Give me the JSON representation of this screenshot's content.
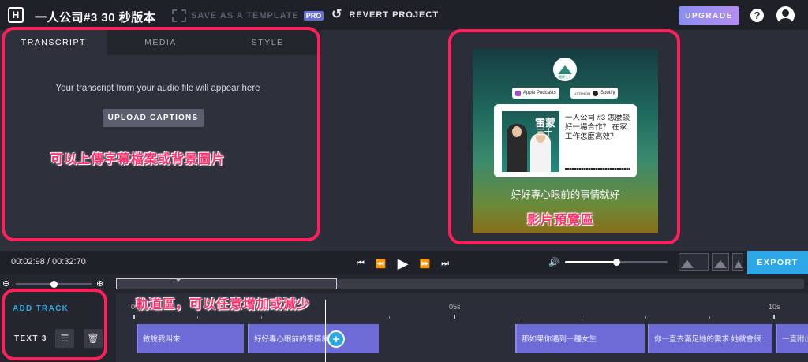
{
  "header": {
    "logo": "H",
    "project_title": "一人公司#3 30 秒版本",
    "save_template": "SAVE AS A TEMPLATE",
    "pro_badge": "PRO",
    "revert": "REVERT PROJECT",
    "upgrade": "UPGRADE",
    "help": "?"
  },
  "left_panel": {
    "tabs": [
      {
        "label": "TRANSCRIPT",
        "active": true
      },
      {
        "label": "MEDIA",
        "active": false
      },
      {
        "label": "STYLE",
        "active": false
      }
    ],
    "message": "Your transcript from your audio file will appear here",
    "upload_button": "UPLOAD CAPTIONS"
  },
  "annotations": {
    "left": "可以上傳字幕檔案或背景圖片",
    "preview": "影片預覽區",
    "timeline": "軌道區，可以任意增加或減少"
  },
  "preview": {
    "logo_text": "雷蒙三十",
    "badge_apple": "Apple Podcasts",
    "badge_spotify": "Spotify",
    "badge_listen": "LISTEN ON",
    "cover_title": "雷蒙",
    "cover_sub": "三十",
    "episode_title": "一人公司 #3 怎麼談好一場合作？ 在家工作怎麼高效？",
    "subtitle": "好好專心眼前的事情就好"
  },
  "playback": {
    "time": "00:02:98 / 00:32:70",
    "volume": 0.5,
    "export": "EXPORT"
  },
  "zoom": {
    "level": 0.5
  },
  "timeline": {
    "add_track": "ADD TRACK",
    "track_label": "TEXT 3",
    "ruler_labels": [
      "0",
      "05s",
      "10s"
    ],
    "clips": [
      {
        "text": "敘說我叫來"
      },
      {
        "text": "好好專心眼前的事情就好"
      },
      {
        "text": "那如果你遇到一種女生"
      },
      {
        "text": "你一直去滿足她的需求 她就會很..."
      },
      {
        "text": "一直附出"
      }
    ]
  },
  "colors": {
    "accent_blue": "#2ea7e6",
    "clip_purple": "#6d6bd6",
    "annotation_red": "#ff1f5a"
  }
}
